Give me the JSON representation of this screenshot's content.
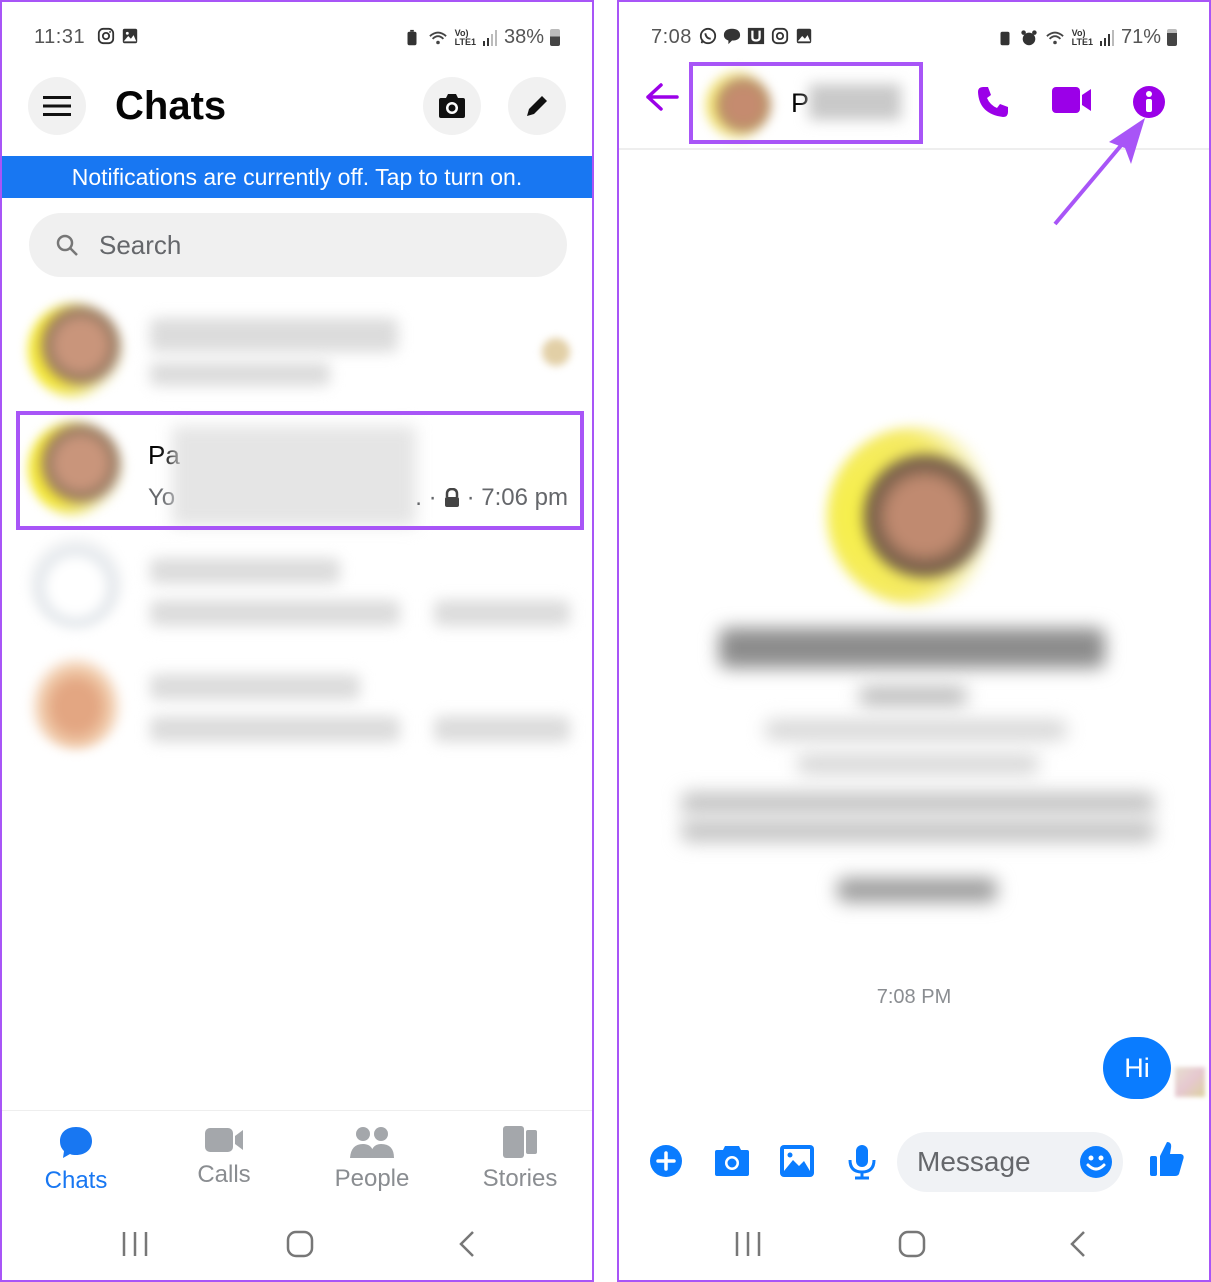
{
  "left_screen": {
    "status_bar": {
      "time": "11:31",
      "left_icons": [
        "instagram-icon",
        "gallery-icon"
      ],
      "right_icons": [
        "battery-saver-icon",
        "wifi-icon",
        "volte-lte1-icon",
        "signal-icon"
      ],
      "battery": "38%"
    },
    "header": {
      "title": "Chats",
      "menu_icon": "hamburger-menu-icon",
      "camera_icon": "camera-icon",
      "compose_icon": "pencil-icon"
    },
    "notification_banner": "Notifications are currently off. Tap to turn on.",
    "search": {
      "placeholder": "Search",
      "value": ""
    },
    "chats": [
      {
        "name": "",
        "preview": "",
        "time": "",
        "redacted": true
      },
      {
        "name_visible": "Pa",
        "preview_visible": "Yo",
        "separator": ". ·",
        "lock_icon": "lock-icon",
        "time": "· 7:06 pm",
        "highlighted": true
      },
      {
        "name": "",
        "preview": "",
        "time": "",
        "redacted": true
      },
      {
        "name": "",
        "preview": "",
        "time": "",
        "redacted": true
      }
    ],
    "tabs": [
      {
        "label": "Chats",
        "icon": "chat-bubble-icon",
        "active": true
      },
      {
        "label": "Calls",
        "icon": "video-camera-icon",
        "active": false
      },
      {
        "label": "People",
        "icon": "people-icon",
        "active": false
      },
      {
        "label": "Stories",
        "icon": "stories-icon",
        "active": false
      }
    ]
  },
  "right_screen": {
    "status_bar": {
      "time": "7:08",
      "left_icons": [
        "whatsapp-icon",
        "chat-icon",
        "u-app-icon",
        "instagram-icon",
        "gallery-icon"
      ],
      "right_icons": [
        "battery-saver-icon",
        "alarm-icon",
        "wifi-icon",
        "volte-lte1-icon",
        "signal-icon"
      ],
      "battery": "71%"
    },
    "thread_header": {
      "contact_name_visible": "P",
      "back_icon": "arrow-left-icon",
      "call_icon": "phone-icon",
      "video_icon": "video-camera-icon",
      "info_icon": "info-icon"
    },
    "conversation": {
      "timestamp": "7:08 PM",
      "messages": [
        {
          "text": "Hi",
          "from": "me"
        }
      ]
    },
    "composer": {
      "placeholder": "Message",
      "value": "",
      "icons": [
        "plus-icon",
        "camera-icon",
        "image-icon",
        "microphone-icon",
        "emoji-icon",
        "thumbs-up-icon"
      ]
    }
  },
  "colors": {
    "accent_blue": "#1877f2",
    "messenger_bubble": "#0a7cff",
    "header_purple": "#9b00e8",
    "annotation_purple": "#a855f7"
  }
}
